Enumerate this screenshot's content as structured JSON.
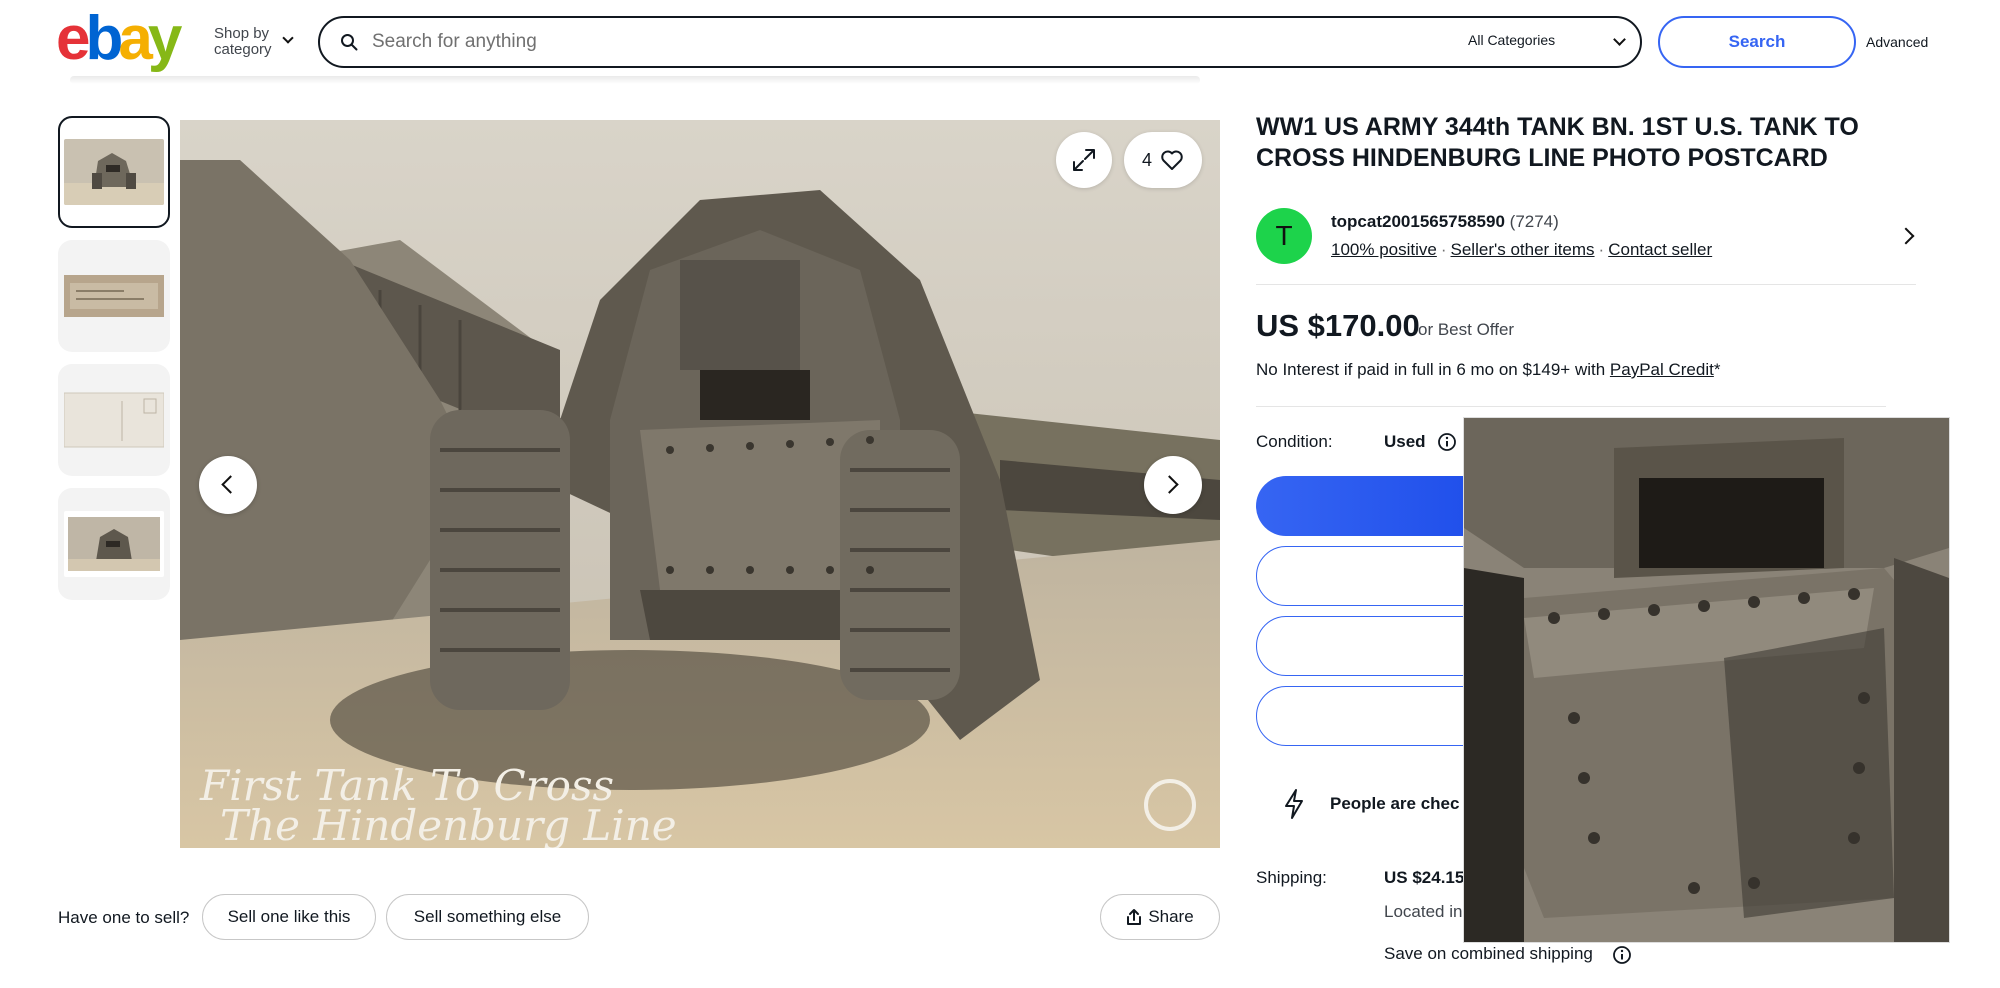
{
  "header": {
    "logo": {
      "l1": "e",
      "l2": "b",
      "l3": "a",
      "l4": "y"
    },
    "shop_by": "Shop by",
    "shop_by_line2": "category",
    "search_placeholder": "Search for anything",
    "category_select": "All Categories",
    "search_button": "Search",
    "advanced_link": "Advanced"
  },
  "gallery": {
    "thumbnail_count": 4,
    "selected_thumbnail": 1,
    "watch_count": "4",
    "photo_caption_line1": "First Tank To Cross",
    "photo_caption_line2": "The Hindenburg Line"
  },
  "sell": {
    "prompt": "Have one to sell?",
    "sell_one_like_this": "Sell one like this",
    "sell_something_else": "Sell something else",
    "share": "Share"
  },
  "listing": {
    "title": "WW1 US ARMY 344th TANK BN. 1ST U.S. TANK TO CROSS HINDENBURG LINE PHOTO POSTCARD",
    "seller": {
      "avatar_letter": "T",
      "name": "topcat2001565758590",
      "feedback_count": "(7274)",
      "positive": "100% positive",
      "other_items": "Seller's other items",
      "contact": "Contact seller"
    },
    "price": "US $170.00",
    "best_offer": "or Best Offer",
    "financing_prefix": "No Interest if paid in full in 6 mo on $149+ with ",
    "financing_link": "PayPal Credit",
    "financing_suffix": "*",
    "condition_label": "Condition:",
    "condition_value": "Used",
    "people_checking": "People are chec",
    "shipping_label": "Shipping:",
    "shipping_value": "US $24.15",
    "located_in": "Located in",
    "combined_shipping": "Save on combined shipping"
  },
  "colors": {
    "accent_blue": "#3665f3",
    "avatar_green": "#1dd34b",
    "text": "#111820"
  }
}
